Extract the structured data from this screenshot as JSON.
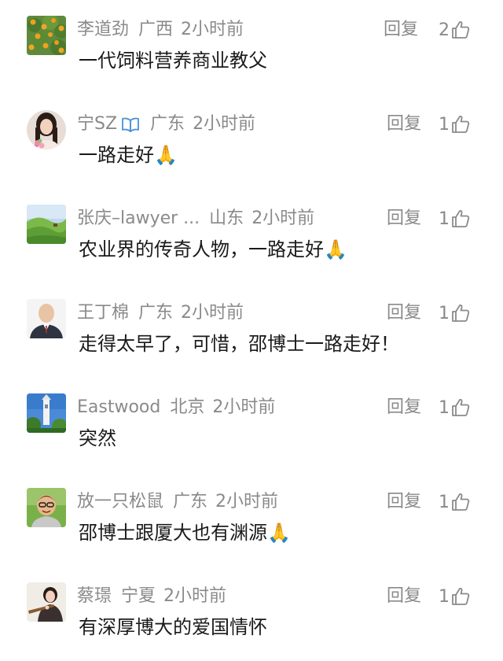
{
  "comments": [
    {
      "name": "李道劲",
      "location": "广西",
      "time": "2小时前",
      "reply": "回复",
      "likes": "2",
      "text": "一代饲料营养商业教父",
      "verified": false,
      "emoji": "",
      "avatar_icon": "orange-tree-avatar"
    },
    {
      "name": "宁SZ",
      "location": "广东",
      "time": "2小时前",
      "reply": "回复",
      "likes": "1",
      "text": "一路走好",
      "verified": true,
      "emoji": "🙏",
      "avatar_icon": "woman-flowers-avatar"
    },
    {
      "name": "张庆–lawyer ...",
      "location": "山东",
      "time": "2小时前",
      "reply": "回复",
      "likes": "1",
      "text": "农业界的传奇人物，一路走好",
      "verified": false,
      "emoji": "🙏",
      "avatar_icon": "green-hills-avatar"
    },
    {
      "name": "王丁棉",
      "location": "广东",
      "time": "2小时前",
      "reply": "回复",
      "likes": "1",
      "text": "走得太早了，可惜，邵博士一路走好！",
      "verified": false,
      "emoji": "",
      "avatar_icon": "man-suit-avatar"
    },
    {
      "name": "Eastwood",
      "location": "北京",
      "time": "2小时前",
      "reply": "回复",
      "likes": "1",
      "text": "突然",
      "verified": false,
      "emoji": "",
      "avatar_icon": "tower-sky-avatar"
    },
    {
      "name": "放一只松鼠",
      "location": "广东",
      "time": "2小时前",
      "reply": "回复",
      "likes": "1",
      "text": "邵博士跟厦大也有渊源",
      "verified": false,
      "emoji": "🙏",
      "avatar_icon": "cartoon-man-avatar"
    },
    {
      "name": "蔡璟",
      "location": "宁夏",
      "time": "2小时前",
      "reply": "回复",
      "likes": "1",
      "text": "有深厚博大的爱国情怀",
      "verified": false,
      "emoji": "",
      "avatar_icon": "woman-instrument-avatar"
    }
  ],
  "colors": {
    "meta_gray": "#8a8a8a",
    "text_dark": "#1a1a1a",
    "verify_blue": "#4a90d9"
  }
}
